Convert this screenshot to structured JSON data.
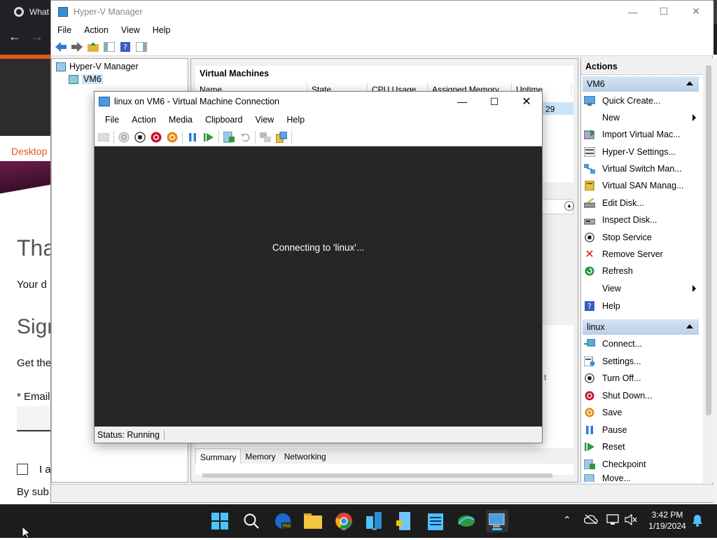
{
  "browser": {
    "tab_title": "What",
    "desktop_link": "Desktop",
    "heading1": "Tha",
    "text1": "Your d",
    "heading2": "Sign",
    "text2": "Get the",
    "email_label": "* Email",
    "checkbox_text": "I a",
    "submit_text": "By sub"
  },
  "hyperv": {
    "title": "Hyper-V Manager",
    "menu": [
      "File",
      "Action",
      "View",
      "Help"
    ],
    "tree": {
      "root": "Hyper-V Manager",
      "server": "VM6"
    },
    "vm_panel_title": "Virtual Machines",
    "vm_columns": [
      "Name",
      "State",
      "CPU Usage",
      "Assigned Memory",
      "Uptime"
    ],
    "vm_partial_uptime": "29",
    "center_partial": "t",
    "center_tabs": [
      "Summary",
      "Memory",
      "Networking"
    ],
    "actions": {
      "title": "Actions",
      "group1": "VM6",
      "group1_items": [
        "Quick Create...",
        "New",
        "Import Virtual Mac...",
        "Hyper-V Settings...",
        "Virtual Switch Man...",
        "Virtual SAN Manag...",
        "Edit Disk...",
        "Inspect Disk...",
        "Stop Service",
        "Remove Server",
        "Refresh",
        "View",
        "Help"
      ],
      "group2": "linux",
      "group2_items": [
        "Connect...",
        "Settings...",
        "Turn Off...",
        "Shut Down...",
        "Save",
        "Pause",
        "Reset",
        "Checkpoint",
        "Move..."
      ]
    }
  },
  "vmconnect": {
    "title": "linux on VM6 - Virtual Machine Connection",
    "menu": [
      "File",
      "Action",
      "Media",
      "Clipboard",
      "View",
      "Help"
    ],
    "message": "Connecting to 'linux'...",
    "status": "Status: Running"
  },
  "taskbar": {
    "time": "3:42 PM",
    "date": "1/19/2024"
  },
  "colors": {
    "accent_blue": "#0078d4",
    "action_header": "#c5d8ef",
    "vm_screen": "#262626",
    "taskbar": "#1c1c1c",
    "ubuntu_orange": "#e95420"
  }
}
